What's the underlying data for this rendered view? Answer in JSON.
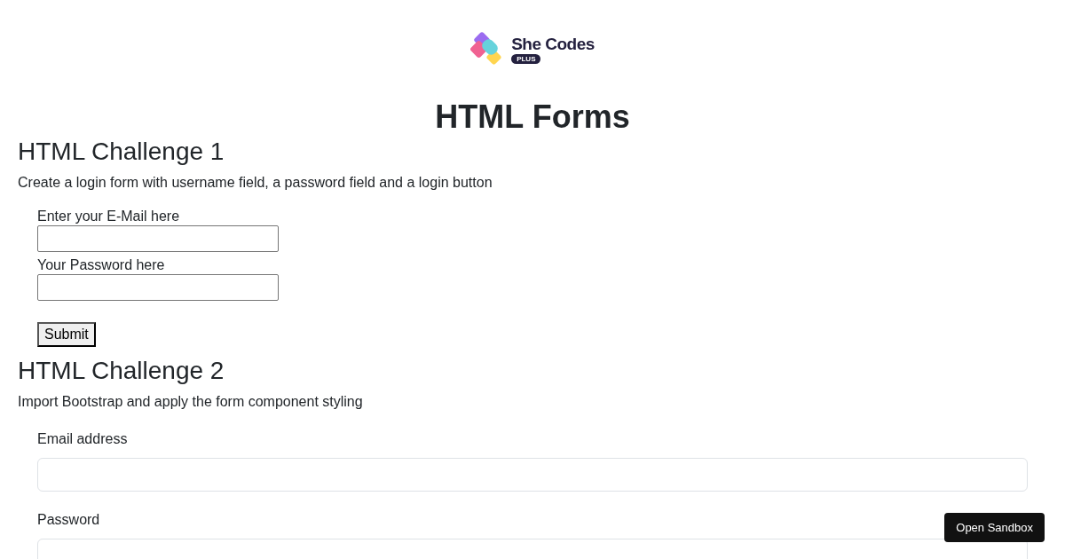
{
  "logo": {
    "name": "She Codes",
    "badge": "PLUS"
  },
  "title": "HTML Forms",
  "challenges": [
    {
      "kind": "plain",
      "heading": "HTML Challenge 1",
      "description": "Create a login form with username field, a password field and a login button",
      "fields": [
        {
          "label": "Enter your E-Mail here"
        },
        {
          "label": "Your Password here"
        }
      ],
      "button": "Submit"
    },
    {
      "kind": "bootstrap",
      "heading": "HTML Challenge 2",
      "description": "Import Bootstrap and apply the form component styling",
      "fields": [
        {
          "label": "Email address"
        },
        {
          "label": "Password"
        }
      ]
    }
  ],
  "sandbox_button": "Open Sandbox"
}
